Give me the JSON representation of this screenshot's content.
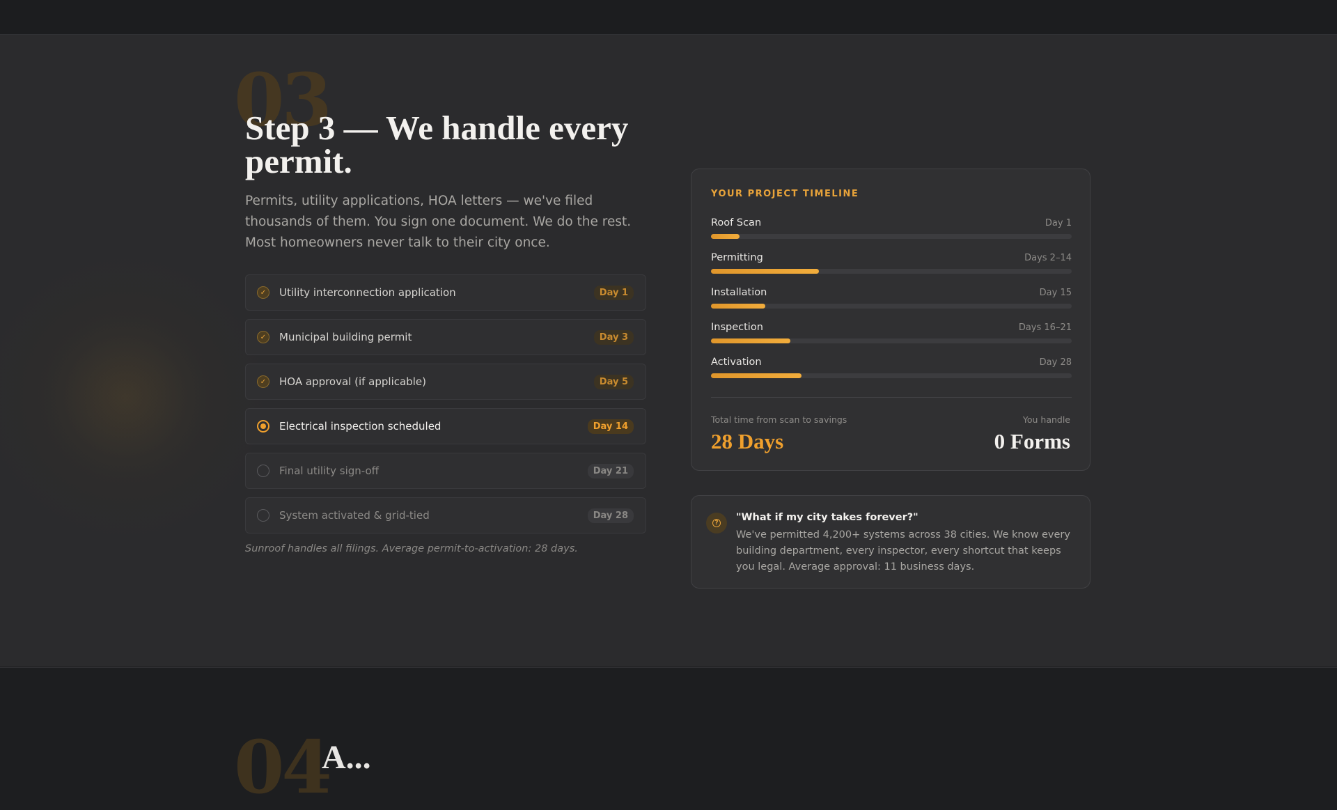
{
  "step": {
    "number": "03",
    "title": "Step 3 — We handle every permit.",
    "lead": "Permits, utility applications, HOA letters — we've filed thousands of them. You sign one document. We do the rest. Most homeowners never talk to their city once."
  },
  "tasks": [
    {
      "label": "Utility interconnection application",
      "badge": "Day 1",
      "status": "done"
    },
    {
      "label": "Municipal building permit",
      "badge": "Day 3",
      "status": "done"
    },
    {
      "label": "HOA approval (if applicable)",
      "badge": "Day 5",
      "status": "done"
    },
    {
      "label": "Electrical inspection scheduled",
      "badge": "Day 14",
      "status": "active"
    },
    {
      "label": "Final utility sign-off",
      "badge": "Day 21",
      "status": "pending"
    },
    {
      "label": "System activated & grid-tied",
      "badge": "Day 28",
      "status": "pending"
    }
  ],
  "note": "Sunroof handles all filings. Average permit-to-activation: 28 days.",
  "timeline": {
    "title": "YOUR PROJECT TIMELINE",
    "phases": [
      {
        "name": "Roof Scan",
        "day": "Day 1",
        "progress": 0.08
      },
      {
        "name": "Permitting",
        "day": "Days 2–14",
        "progress": 0.3
      },
      {
        "name": "Installation",
        "day": "Day 15",
        "progress": 0.15
      },
      {
        "name": "Inspection",
        "day": "Days 16–21",
        "progress": 0.22
      },
      {
        "name": "Activation",
        "day": "Day 28",
        "progress": 0.25
      }
    ],
    "total_caption": "Total time from scan to savings",
    "total_value": "28 Days",
    "handle_caption": "You handle",
    "handle_value": "0 Forms"
  },
  "faq": {
    "question": "\"What if my city takes forever?\"",
    "answer": "We've permitted 4,200+ systems across 38 cities. We know every building department, every inspector, every shortcut that keeps you legal. Average approval: 11 business days."
  },
  "next_step": {
    "number": "04",
    "title_fragment": "A..."
  },
  "colors": {
    "accent": "#f0a02d",
    "background": "#2b2b2d",
    "page": "#1d1e20"
  }
}
